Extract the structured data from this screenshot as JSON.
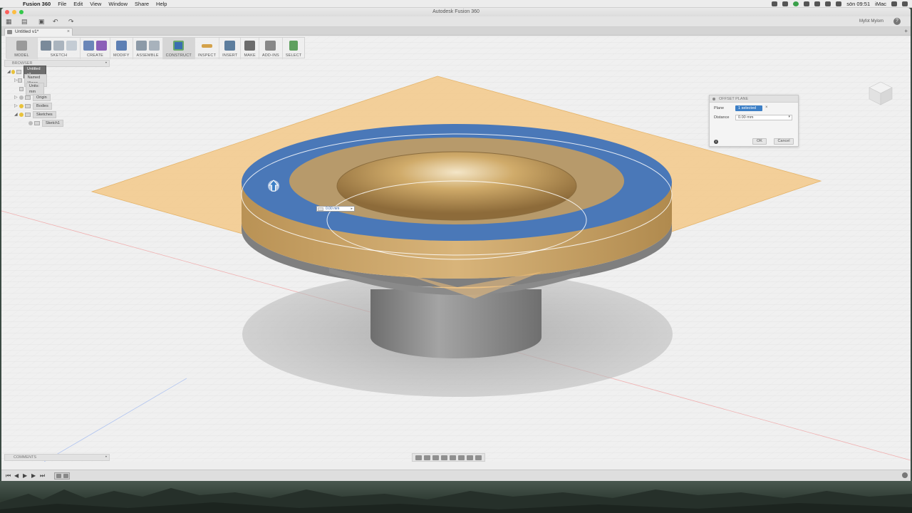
{
  "menubar": {
    "app_name": "Fusion 360",
    "items": [
      "File",
      "Edit",
      "View",
      "Window",
      "Share",
      "Help"
    ],
    "clock": "sön 09:51",
    "computer_name": "iMac"
  },
  "window": {
    "title": "Autodesk Fusion 360",
    "user_menu": "Myfot Mylom",
    "help_label": "?",
    "doc_tab": "Untitled v1*",
    "tab_close": "×",
    "tab_add": "+"
  },
  "ribbon": {
    "groups": [
      {
        "label": "MODEL",
        "icons": [
          "model-workspace-icon"
        ],
        "color": "#9a9a9a"
      },
      {
        "label": "SKETCH",
        "icons": [
          "create-sketch-icon",
          "line-icon",
          "rectangle-icon"
        ],
        "color": "#7a8a9a"
      },
      {
        "label": "CREATE",
        "icons": [
          "box-icon",
          "sphere-icon"
        ],
        "color": "#6a86b8"
      },
      {
        "label": "MODIFY",
        "icons": [
          "press-pull-icon"
        ],
        "color": "#5d7fb4"
      },
      {
        "label": "ASSEMBLE",
        "icons": [
          "new-component-icon",
          "joint-icon"
        ],
        "color": "#8c9aa8"
      },
      {
        "label": "CONSTRUCT",
        "icons": [
          "offset-plane-icon"
        ],
        "color": "#3a6fb0"
      },
      {
        "label": "INSPECT",
        "icons": [
          "measure-icon"
        ],
        "color": "#d4a24a"
      },
      {
        "label": "INSERT",
        "icons": [
          "insert-image-icon"
        ],
        "color": "#5d7e9e"
      },
      {
        "label": "MAKE",
        "icons": [
          "3d-print-icon"
        ],
        "color": "#6b6b6b"
      },
      {
        "label": "ADD-INS",
        "icons": [
          "scripts-icon"
        ],
        "color": "#888888"
      },
      {
        "label": "SELECT",
        "icons": [
          "select-icon"
        ],
        "color": "#5ea05e"
      }
    ]
  },
  "browser": {
    "title": "BROWSER",
    "pin": "•",
    "root": "Untitled v1",
    "items": [
      "Named Views",
      "Units: mm",
      "Origin",
      "Bodies",
      "Sketches",
      "Sketch1"
    ]
  },
  "dialog": {
    "title": "OFFSET PLANE",
    "plane_label": "Plane",
    "plane_value": "1 selected",
    "plane_clear": "×",
    "distance_label": "Distance",
    "distance_value": "0.00 mm",
    "dropdown_arrow": "▾",
    "ok": "OK",
    "cancel": "Cancel",
    "info": "i"
  },
  "canvas": {
    "value_box": "0.00 mm",
    "value_arrow": "▸"
  },
  "comments": {
    "title": "COMMENTS",
    "pin": "•"
  },
  "timeline": {
    "controls": [
      "⏮",
      "◀",
      "▶",
      "▶",
      "⏭"
    ]
  },
  "colors": {
    "selection_blue": "#4a78b8",
    "plane_orange": "#f0c27a",
    "body_gold": "#c9a268",
    "body_grey": "#8d8d8d",
    "accent": "#3c7fc6"
  }
}
